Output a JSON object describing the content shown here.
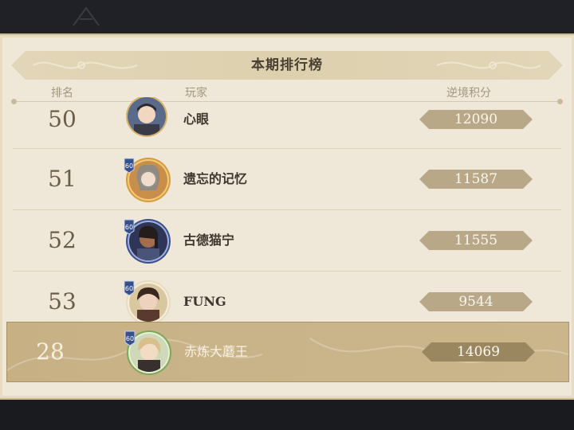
{
  "leaderboard": {
    "title": "本期排行榜",
    "columns": {
      "rank": "排名",
      "player": "玩家",
      "score": "逆境积分"
    },
    "rows": [
      {
        "rank": "50",
        "name": "心眼",
        "score": "12090",
        "level_badge": ""
      },
      {
        "rank": "51",
        "name": "遗忘的记忆",
        "score": "11587",
        "level_badge": "60"
      },
      {
        "rank": "52",
        "name": "古德猫宁",
        "score": "11555",
        "level_badge": "60"
      },
      {
        "rank": "53",
        "name": "FUNG",
        "score": "9544",
        "level_badge": "60"
      }
    ],
    "self_row": {
      "rank": "28",
      "name": "赤炼大蘑王",
      "score": "14069",
      "level_badge": "60"
    }
  },
  "colors": {
    "panel": "#efe8d8",
    "pill": "#b8a887",
    "highlight": "#c9b388"
  }
}
